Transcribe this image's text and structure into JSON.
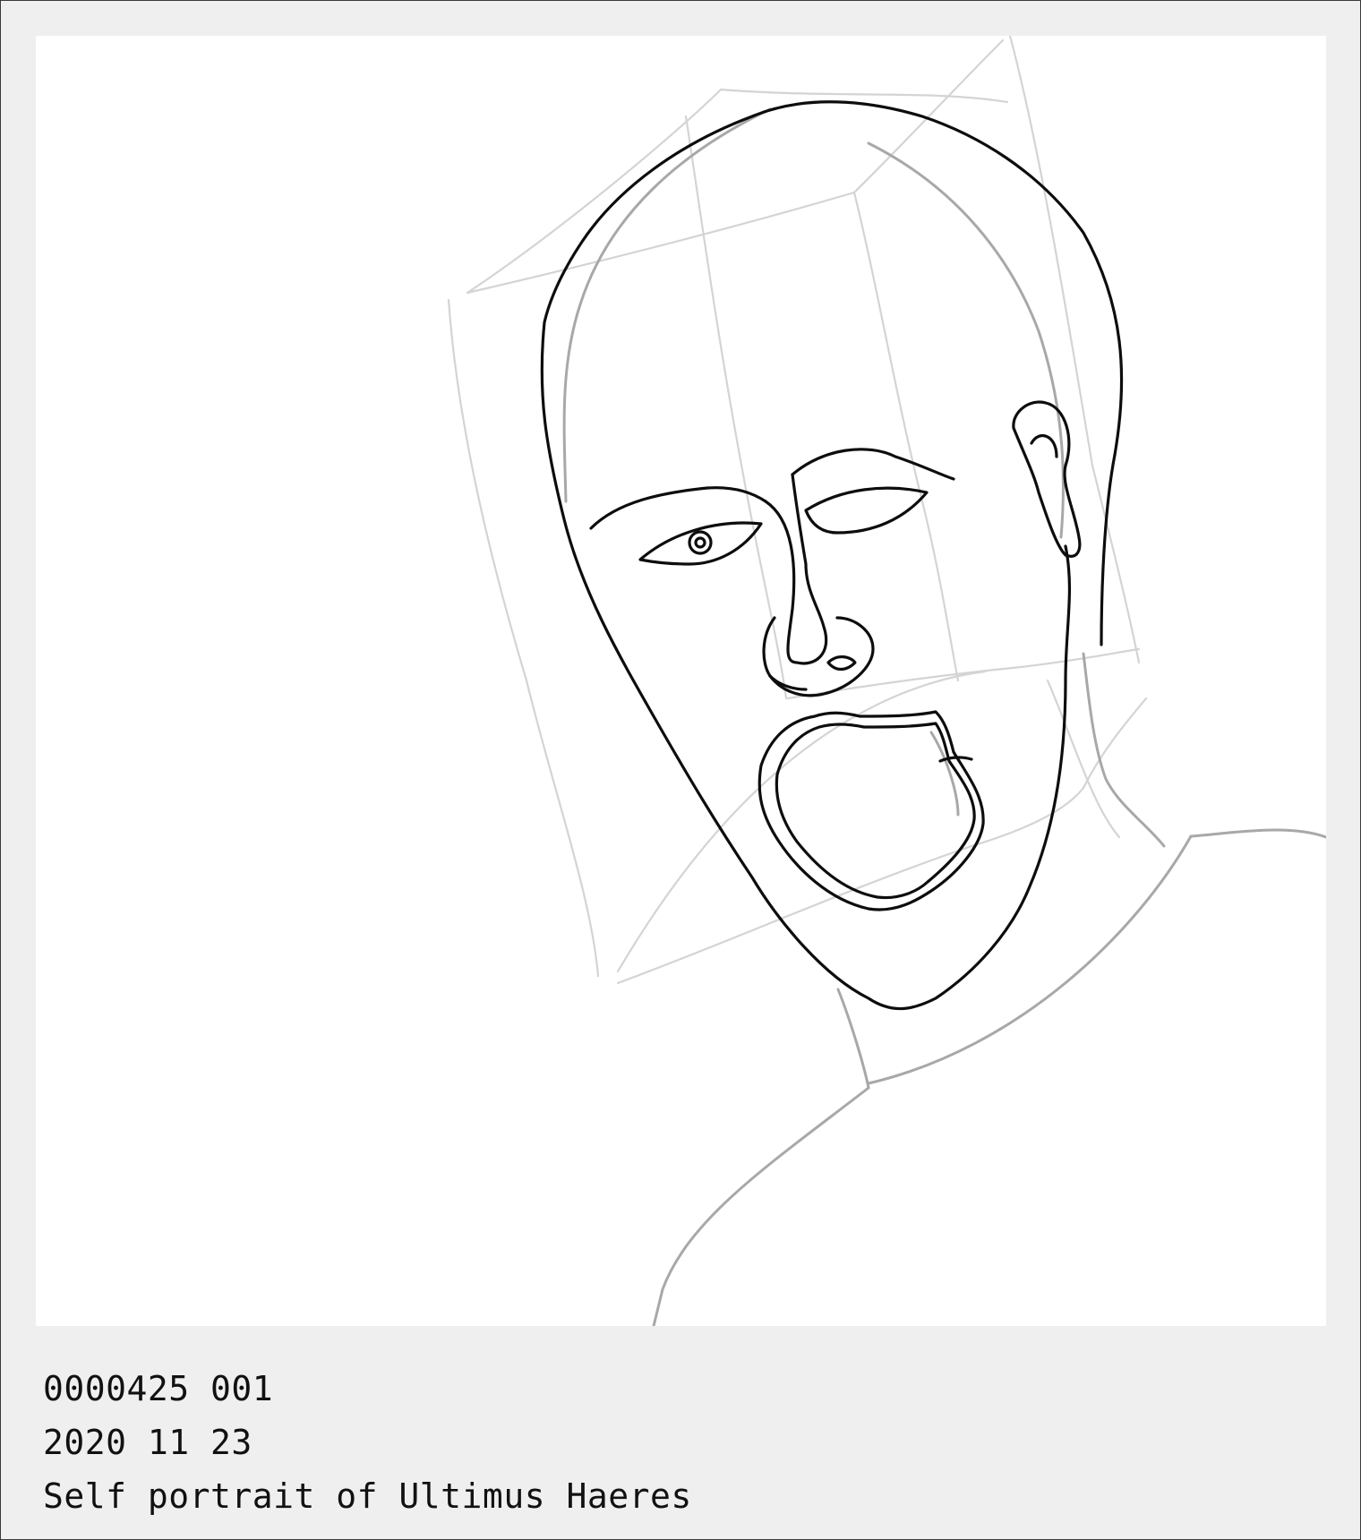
{
  "drawing": {
    "subject": "portrait-sketch"
  },
  "caption": {
    "line1": "0000425 001",
    "line2": "2020 11 23",
    "line3": "Self portrait of Ultimus Haeres"
  },
  "colors": {
    "frame_background": "#efefef",
    "canvas_background": "#ffffff",
    "ink": "#0d0d0d",
    "guide_lines": "#d4d4d4",
    "body_lines": "#a8a8a8"
  }
}
